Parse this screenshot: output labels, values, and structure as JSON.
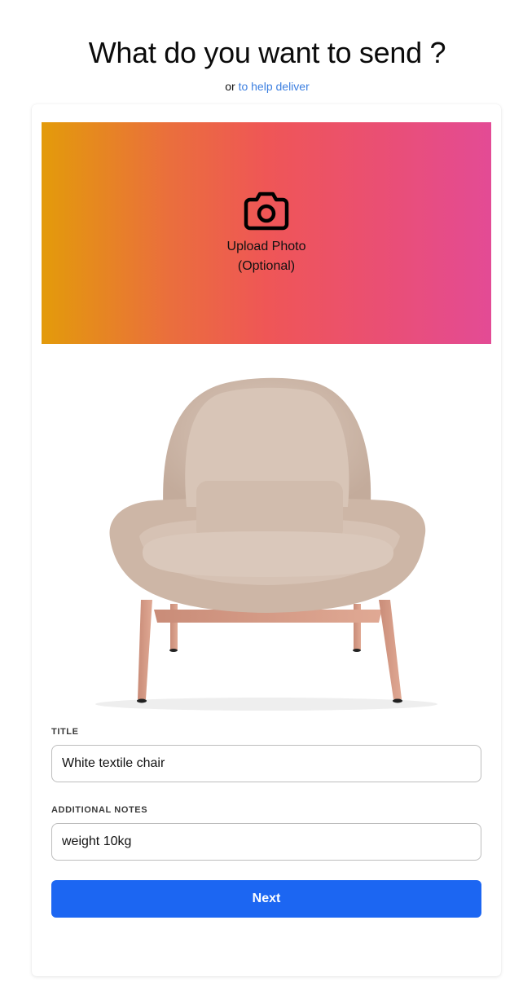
{
  "header": {
    "title": "What do you want to send ?",
    "or_text": "or",
    "help_link": "to help deliver"
  },
  "upload": {
    "icon": "camera-icon",
    "line1": "Upload Photo",
    "line2": "(Optional)"
  },
  "item_image": {
    "description_icon": "chair-photo"
  },
  "form": {
    "title_label": "TITLE",
    "title_value": "White textile chair",
    "notes_label": "ADDITIONAL NOTES",
    "notes_value": "weight 10kg",
    "next_label": "Next"
  },
  "colors": {
    "gradient_start": "#e39b0a",
    "gradient_mid": "#ef5656",
    "gradient_end": "#e34b95",
    "link": "#3c7fe0",
    "button": "#1c66f2"
  }
}
